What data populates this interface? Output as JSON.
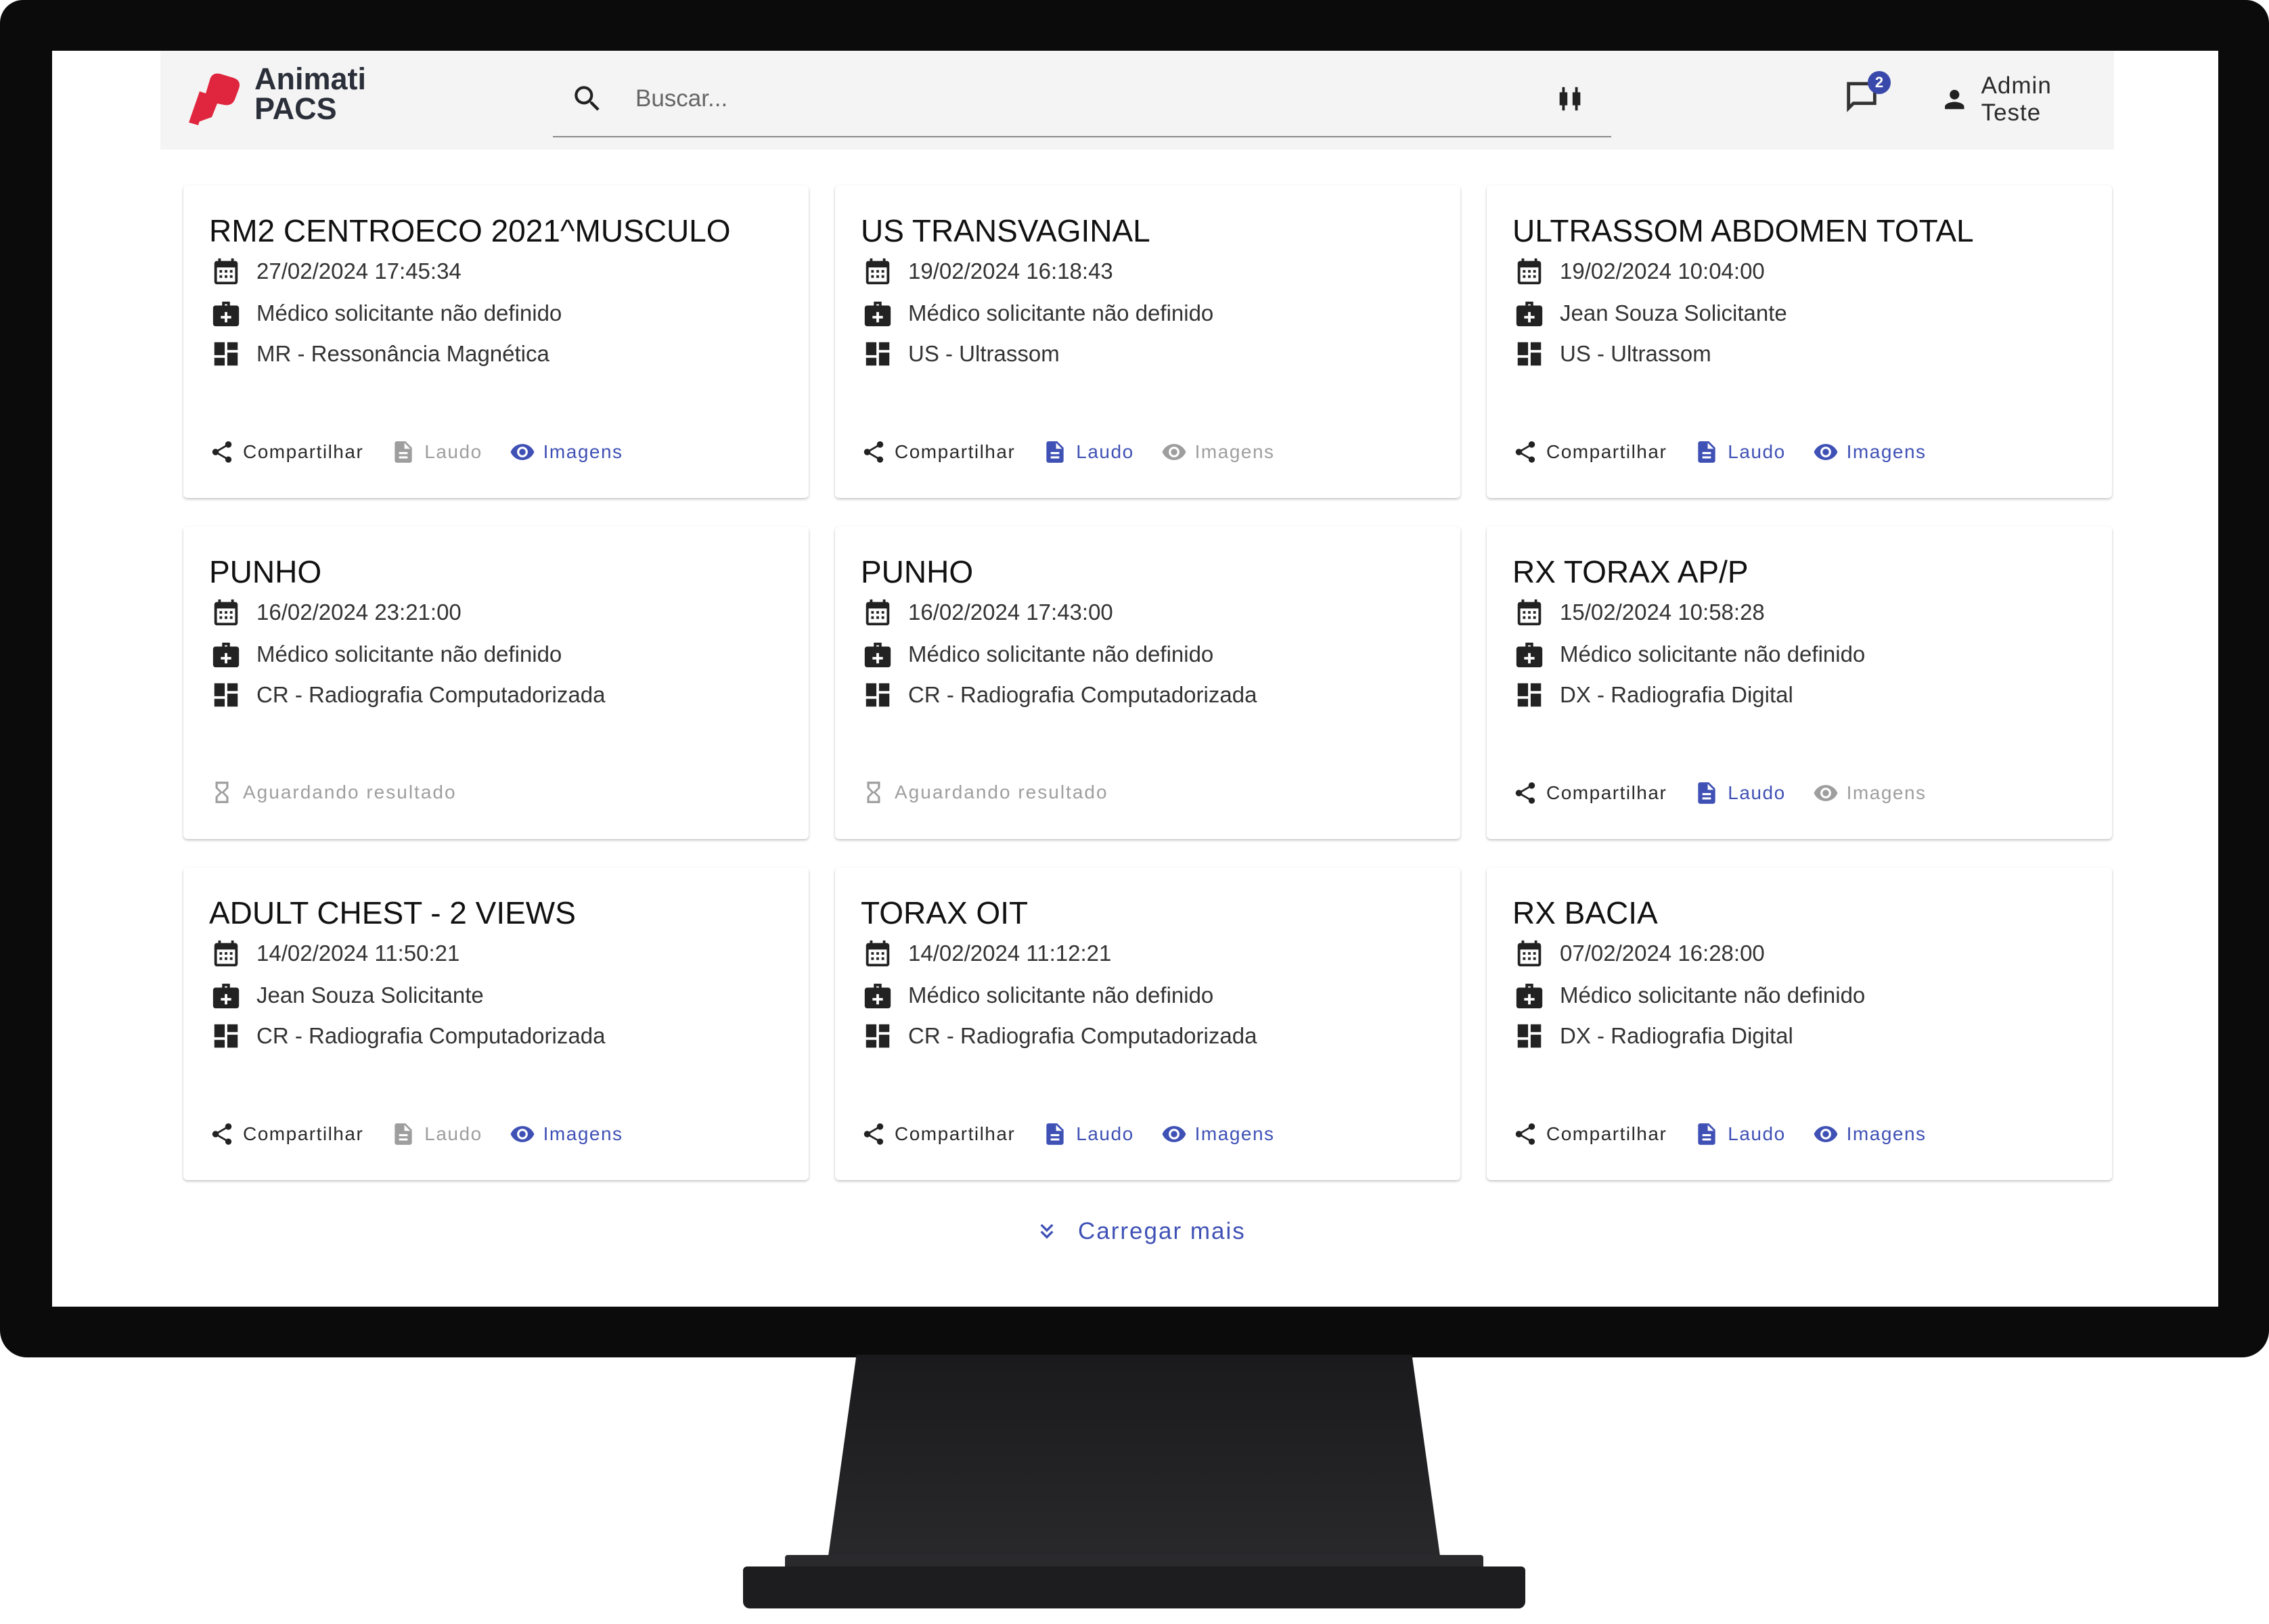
{
  "app": {
    "brand_line1": "Animati",
    "brand_line2": "PACS",
    "brand_color": "#e0263e",
    "accent_color": "#3f51b5"
  },
  "search": {
    "placeholder": "Buscar..."
  },
  "notifications": {
    "count": "2"
  },
  "user": {
    "name": "Admin Teste"
  },
  "icons": {
    "date": "calendar-icon",
    "doctor": "medical-bag-icon",
    "modality": "dashboard-grid-icon",
    "share": "share-icon",
    "report": "document-icon",
    "images": "eye-icon",
    "waiting": "hourglass-icon",
    "load_more": "double-chevron-down-icon"
  },
  "actions": {
    "share": "Compartilhar",
    "report": "Laudo",
    "images": "Imagens",
    "waiting": "Aguardando resultado"
  },
  "exams": [
    {
      "title": "RM2 CENTROECO 2021^MUSCULO",
      "date": "27/02/2024 17:45:34",
      "doctor": "Médico solicitante não definido",
      "modality": "MR - Ressonância Magnética",
      "status": "ready",
      "report_enabled": false,
      "images_enabled": true
    },
    {
      "title": "US TRANSVAGINAL",
      "date": "19/02/2024 16:18:43",
      "doctor": "Médico solicitante não definido",
      "modality": "US - Ultrassom",
      "status": "ready",
      "report_enabled": true,
      "images_enabled": false
    },
    {
      "title": "ULTRASSOM ABDOMEN TOTAL",
      "date": "19/02/2024 10:04:00",
      "doctor": "Jean Souza Solicitante",
      "modality": "US - Ultrassom",
      "status": "ready",
      "report_enabled": true,
      "images_enabled": true
    },
    {
      "title": "PUNHO",
      "date": "16/02/2024 23:21:00",
      "doctor": "Médico solicitante não definido",
      "modality": "CR - Radiografia Computadorizada",
      "status": "waiting"
    },
    {
      "title": "PUNHO",
      "date": "16/02/2024 17:43:00",
      "doctor": "Médico solicitante não definido",
      "modality": "CR - Radiografia Computadorizada",
      "status": "waiting"
    },
    {
      "title": "RX TORAX AP/P",
      "date": "15/02/2024 10:58:28",
      "doctor": "Médico solicitante não definido",
      "modality": "DX - Radiografia Digital",
      "status": "ready",
      "report_enabled": true,
      "images_enabled": false
    },
    {
      "title": "ADULT CHEST - 2 VIEWS",
      "date": "14/02/2024 11:50:21",
      "doctor": "Jean Souza Solicitante",
      "modality": "CR - Radiografia Computadorizada",
      "status": "ready",
      "report_enabled": false,
      "images_enabled": true
    },
    {
      "title": "TORAX OIT",
      "date": "14/02/2024 11:12:21",
      "doctor": "Médico solicitante não definido",
      "modality": "CR - Radiografia Computadorizada",
      "status": "ready",
      "report_enabled": true,
      "images_enabled": true
    },
    {
      "title": "RX BACIA",
      "date": "07/02/2024 16:28:00",
      "doctor": "Médico solicitante não definido",
      "modality": "DX - Radiografia Digital",
      "status": "ready",
      "report_enabled": true,
      "images_enabled": true
    }
  ],
  "load_more": {
    "label": "Carregar mais"
  }
}
